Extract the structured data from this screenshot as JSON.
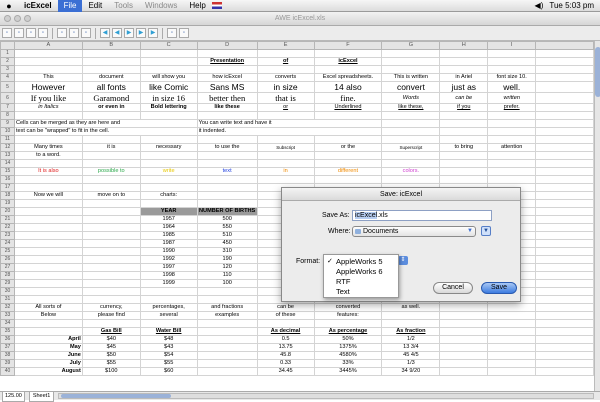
{
  "menubar": {
    "app_name": "icExcel",
    "items": [
      "File",
      "Edit",
      "Tools",
      "Windows",
      "Help"
    ],
    "active_item": "File",
    "clock": "Tue 5:03 pm"
  },
  "window": {
    "title": "AWE icExcel.xls"
  },
  "columns": [
    "A",
    "B",
    "C",
    "D",
    "E",
    "F",
    "G",
    "H",
    "I"
  ],
  "rows": [
    {
      "n": "1",
      "c": [
        "",
        "",
        "",
        "",
        "",
        "",
        "",
        "",
        ""
      ]
    },
    {
      "n": "2",
      "c": [
        "",
        "",
        "",
        "Presentation",
        "of",
        "icExcel",
        "",
        "",
        ""
      ]
    },
    {
      "n": "3",
      "c": [
        "",
        "",
        "",
        "",
        "",
        "",
        "",
        "",
        ""
      ]
    },
    {
      "n": "4",
      "c": [
        "This",
        "document",
        "will show you",
        "how icExcel",
        "converts",
        "Excel spreadsheets.",
        "This is written",
        "in Ariel",
        "font size 10."
      ]
    },
    {
      "n": "5",
      "c": [
        "However",
        "all fonts",
        "like Comic",
        "Sans MS",
        "in size",
        "14 also",
        "convert",
        "just as",
        "well."
      ]
    },
    {
      "n": "6",
      "c": [
        "If you like",
        "Garamond",
        "in size 16",
        "better then",
        "that is",
        "fine.",
        "Words",
        "can be",
        "written"
      ]
    },
    {
      "n": "7",
      "c": [
        "in Italics",
        "or even in",
        "Bold lettering",
        "like these",
        "or",
        "Underlined",
        "like these,",
        "if you",
        "prefer."
      ]
    },
    {
      "n": "8",
      "c": [
        "",
        "",
        "",
        "",
        "",
        "",
        "",
        "",
        ""
      ]
    },
    {
      "n": "9",
      "c": [
        "Cells can be merged as they are here and",
        "",
        "",
        "You can write text and have it",
        "",
        "",
        "",
        "",
        ""
      ]
    },
    {
      "n": "10",
      "c": [
        "text can be \"wrapped\" to fit in the cell.",
        "",
        "",
        "it indented.",
        "",
        "",
        "",
        "",
        ""
      ]
    },
    {
      "n": "11",
      "c": [
        "",
        "",
        "",
        "",
        "",
        "",
        "",
        "",
        ""
      ]
    },
    {
      "n": "12",
      "c": [
        "Many times",
        "it is",
        "necessary",
        "to use the",
        "Subscript",
        "or the",
        "Superscript",
        "to bring",
        "attention"
      ]
    },
    {
      "n": "13",
      "c": [
        "to a word.",
        "",
        "",
        "",
        "",
        "",
        "",
        "",
        ""
      ]
    },
    {
      "n": "14",
      "c": [
        "",
        "",
        "",
        "",
        "",
        "",
        "",
        "",
        ""
      ]
    },
    {
      "n": "15",
      "c": [
        "It is also",
        "possible to",
        "write",
        "text",
        "in",
        "different",
        "colors.",
        "",
        ""
      ]
    },
    {
      "n": "16",
      "c": [
        "",
        "",
        "",
        "",
        "",
        "",
        "",
        "",
        ""
      ]
    },
    {
      "n": "17",
      "c": [
        "",
        "",
        "",
        "",
        "",
        "",
        "",
        "",
        ""
      ]
    },
    {
      "n": "18",
      "c": [
        "Now we will",
        "move on to",
        "charts:",
        "",
        "",
        "",
        "",
        "",
        ""
      ]
    },
    {
      "n": "19",
      "c": [
        "",
        "",
        "",
        "",
        "",
        "",
        "",
        "",
        ""
      ]
    },
    {
      "n": "20",
      "c": [
        "",
        "",
        "YEAR",
        "NUMBER OF BIRTHS",
        "",
        "",
        "",
        "",
        ""
      ]
    },
    {
      "n": "21",
      "c": [
        "",
        "",
        "1957",
        "500",
        "",
        "",
        "",
        "",
        ""
      ]
    },
    {
      "n": "22",
      "c": [
        "",
        "",
        "1964",
        "550",
        "",
        "",
        "",
        "",
        ""
      ]
    },
    {
      "n": "23",
      "c": [
        "",
        "",
        "1985",
        "510",
        "",
        "",
        "",
        "",
        ""
      ]
    },
    {
      "n": "24",
      "c": [
        "",
        "",
        "1987",
        "450",
        "",
        "",
        "",
        "",
        ""
      ]
    },
    {
      "n": "25",
      "c": [
        "",
        "",
        "1990",
        "310",
        "",
        "",
        "",
        "",
        ""
      ]
    },
    {
      "n": "26",
      "c": [
        "",
        "",
        "1992",
        "190",
        "",
        "",
        "",
        "",
        ""
      ]
    },
    {
      "n": "27",
      "c": [
        "",
        "",
        "1997",
        "120",
        "",
        "",
        "",
        "",
        ""
      ]
    },
    {
      "n": "28",
      "c": [
        "",
        "",
        "1998",
        "110",
        "",
        "",
        "",
        "",
        ""
      ]
    },
    {
      "n": "29",
      "c": [
        "",
        "",
        "1999",
        "100",
        "",
        "",
        "",
        "",
        ""
      ]
    },
    {
      "n": "30",
      "c": [
        "",
        "",
        "",
        "",
        "",
        "",
        "",
        "",
        ""
      ]
    },
    {
      "n": "31",
      "c": [
        "",
        "",
        "",
        "",
        "",
        "",
        "",
        "",
        ""
      ]
    },
    {
      "n": "32",
      "c": [
        "All sorts of",
        "currency,",
        "percentages,",
        "and fractions",
        "can be",
        "converted",
        "as well.",
        "",
        ""
      ]
    },
    {
      "n": "33",
      "c": [
        "Below",
        "please find",
        "several",
        "examples",
        "of these",
        "features:",
        "",
        "",
        ""
      ]
    },
    {
      "n": "34",
      "c": [
        "",
        "",
        "",
        "",
        "",
        "",
        "",
        "",
        ""
      ]
    },
    {
      "n": "35",
      "c": [
        "",
        "Gas Bill",
        "Water Bill",
        "",
        "As decimal",
        "As percentage",
        "As fraction",
        "",
        ""
      ]
    },
    {
      "n": "36",
      "c": [
        "April",
        "$40",
        "$48",
        "",
        "0.5",
        "50%",
        "1/2",
        "",
        ""
      ]
    },
    {
      "n": "37",
      "c": [
        "May",
        "$45",
        "$43",
        "",
        "13.75",
        "1375%",
        "13  3/4",
        "",
        ""
      ]
    },
    {
      "n": "38",
      "c": [
        "June",
        "$50",
        "$54",
        "",
        "45.8",
        "4580%",
        "45  4/5",
        "",
        ""
      ]
    },
    {
      "n": "39",
      "c": [
        "July",
        "$55",
        "$55",
        "",
        "0.33",
        "33%",
        "1/3",
        "",
        ""
      ]
    },
    {
      "n": "40",
      "c": [
        "August",
        "$100",
        "$60",
        "",
        "34.45",
        "3445%",
        "34  9/20",
        "",
        ""
      ]
    }
  ],
  "status": {
    "zoom": "125.00",
    "sheet_tab": "Sheet1"
  },
  "dialog": {
    "title": "Save: icExcel",
    "save_as_label": "Save As:",
    "save_as_name": "icExcel",
    "save_as_ext": ".xls",
    "where_label": "Where:",
    "where_value": "Documents",
    "format_label": "Format:",
    "cancel_label": "Cancel",
    "save_label": "Save"
  },
  "format_menu": {
    "options": [
      "AppleWorks 5",
      "AppleWorks 6",
      "RTF",
      "Text"
    ],
    "selected": "AppleWorks 5",
    "check": "✓"
  },
  "colors": {
    "text_red": "#e02020",
    "text_green": "#2aa84a",
    "text_yellow": "#e8c800",
    "text_blue": "#2040e0",
    "text_orange": "#f08a00",
    "text_magenta": "#d040d0",
    "accent": "#3b6fd4"
  }
}
